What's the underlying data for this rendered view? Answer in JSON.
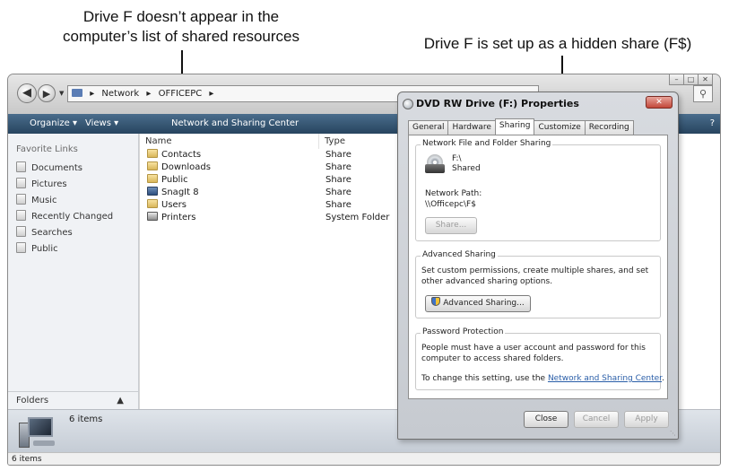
{
  "callouts": {
    "left": [
      "Drive F doesn’t appear in the",
      "computer’s list of shared resources"
    ],
    "right": "Drive F is set up as a hidden share (F$)"
  },
  "explorer": {
    "address": {
      "segments": [
        "Network",
        "OFFICEPC"
      ],
      "separator": "▸"
    },
    "window_controls": [
      "–",
      "□",
      "✕"
    ],
    "toolbar": {
      "organize": "Organize ▾",
      "views": "Views ▾",
      "network_center": "Network and Sharing Center",
      "help": "?"
    },
    "favorites": {
      "title": "Favorite Links",
      "items": [
        "Documents",
        "Pictures",
        "Music",
        "Recently Changed",
        "Searches",
        "Public"
      ]
    },
    "folders_label": "Folders",
    "columns": {
      "name": "Name",
      "type": "Type"
    },
    "files": [
      {
        "name": "Contacts",
        "type": "Share"
      },
      {
        "name": "Downloads",
        "type": "Share"
      },
      {
        "name": "Public",
        "type": "Share"
      },
      {
        "name": "SnagIt 8",
        "type": "Share"
      },
      {
        "name": "Users",
        "type": "Share"
      },
      {
        "name": "Printers",
        "type": "System Folder"
      }
    ],
    "details_count": "6 items",
    "status": "6 items"
  },
  "dialog": {
    "title": "DVD RW Drive (F:) Properties",
    "tabs": [
      "General",
      "Hardware",
      "Sharing",
      "Customize",
      "Recording"
    ],
    "active_tab": "Sharing",
    "network_sharing": {
      "title": "Network File and Folder Sharing",
      "drive": "F:\\",
      "status": "Shared",
      "path_label": "Network Path:",
      "path": "\\\\Officepc\\F$",
      "share_button": "Share..."
    },
    "advanced": {
      "title": "Advanced Sharing",
      "description": "Set custom permissions, create multiple shares, and set other advanced sharing options.",
      "button": "Advanced Sharing..."
    },
    "password": {
      "title": "Password Protection",
      "description": "People must have a user account and password for this computer to access shared folders.",
      "change_prefix": "To change this setting, use the ",
      "link": "Network and Sharing Center",
      "change_suffix": "."
    },
    "buttons": {
      "close": "Close",
      "cancel": "Cancel",
      "apply": "Apply"
    }
  }
}
